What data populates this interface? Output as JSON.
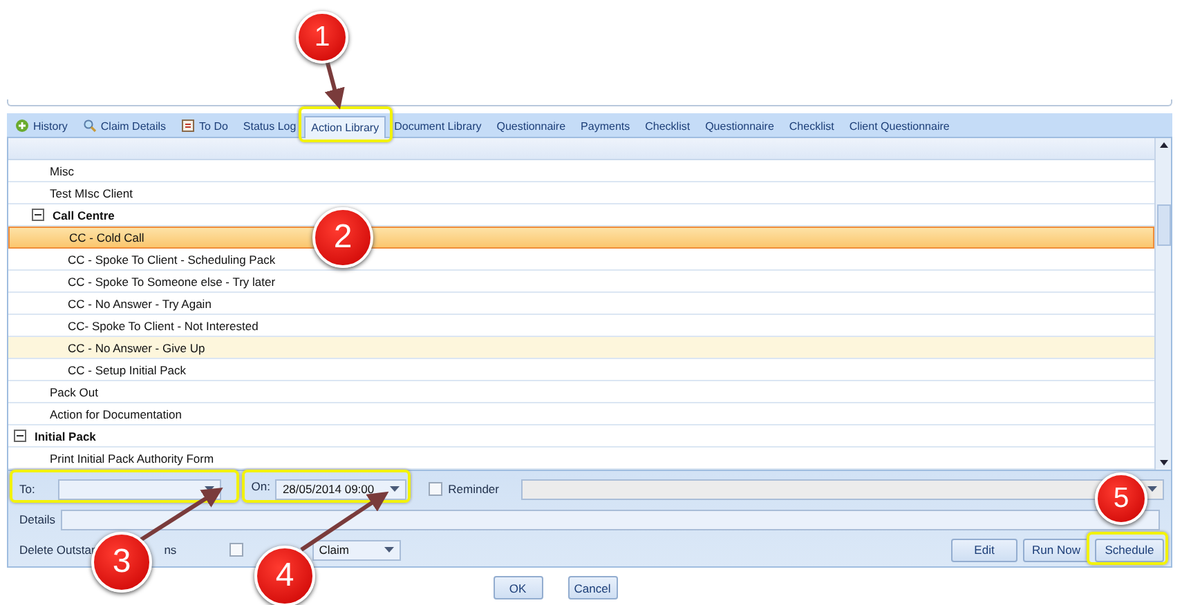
{
  "tabs": [
    {
      "label": "History",
      "selected": false
    },
    {
      "label": "Claim Details",
      "selected": false
    },
    {
      "label": "To Do",
      "selected": false
    },
    {
      "label": "Status Log",
      "selected": false
    },
    {
      "label": "Action Library",
      "selected": true
    },
    {
      "label": "Document Library",
      "selected": false
    },
    {
      "label": "Questionnaire",
      "selected": false
    },
    {
      "label": "Payments",
      "selected": false
    },
    {
      "label": "Checklist",
      "selected": false
    },
    {
      "label": "Questionnaire",
      "selected": false
    },
    {
      "label": "Checklist",
      "selected": false
    },
    {
      "label": "Client Questionnaire",
      "selected": false
    }
  ],
  "tree": [
    {
      "kind": "continuation",
      "children": [
        {
          "label": "Misc",
          "selected": false,
          "highlighted": false
        },
        {
          "label": "Test MIsc Client",
          "selected": false,
          "highlighted": false
        },
        {
          "label": "Call Centre",
          "expanded": true,
          "children": [
            {
              "label": "CC - Cold Call",
              "selected": true,
              "highlighted": false
            },
            {
              "label": "CC - Spoke To Client - Scheduling Pack",
              "selected": false,
              "highlighted": false
            },
            {
              "label": "CC - Spoke To Someone else - Try later",
              "selected": false,
              "highlighted": false
            },
            {
              "label": "CC - No Answer - Try Again",
              "selected": false,
              "highlighted": false
            },
            {
              "label": "CC- Spoke To Client - Not Interested",
              "selected": false,
              "highlighted": false
            },
            {
              "label": "CC - No Answer - Give Up",
              "selected": false,
              "highlighted": true
            },
            {
              "label": "CC - Setup Initial Pack",
              "selected": false,
              "highlighted": false
            }
          ]
        },
        {
          "label": "Pack Out",
          "selected": false,
          "highlighted": false
        },
        {
          "label": "Action for Documentation",
          "selected": false,
          "highlighted": false
        }
      ]
    },
    {
      "label": "Initial Pack",
      "expanded": true,
      "children": [
        {
          "label": "Print Initial Pack Authority Form",
          "selected": false,
          "highlighted": false
        }
      ]
    }
  ],
  "form": {
    "to_label": "To:",
    "on_label": "On:",
    "on_value": "28/05/2014 09:00",
    "reminder": {
      "label": "Reminder",
      "checked": false
    },
    "details_label": "Details",
    "delete_label_parts": [
      "Delete Outstan",
      "ns"
    ],
    "delete_checked": false,
    "claim_value": "Claim"
  },
  "action_buttons": [
    "Edit",
    "Run Now",
    "Schedule"
  ],
  "dialog_buttons": [
    "OK",
    "Cancel"
  ],
  "callouts": [
    "1",
    "2",
    "3",
    "4",
    "5"
  ]
}
